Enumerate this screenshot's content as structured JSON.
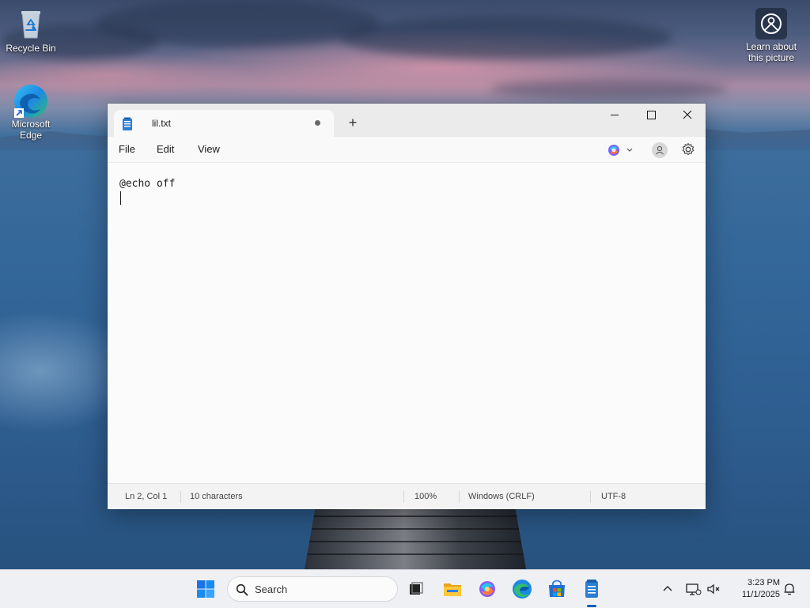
{
  "desktop": {
    "icons": [
      {
        "label": "Recycle Bin",
        "icon": "recycle-bin-icon"
      },
      {
        "label": "Microsoft Edge",
        "icon": "edge-icon"
      }
    ],
    "spotlight": {
      "label": "Learn about this picture",
      "icon": "camera-info-icon"
    }
  },
  "notepad": {
    "tab": {
      "title": "lil.txt",
      "unsaved_indicator": "•",
      "new_tab_symbol": "+"
    },
    "window_controls": [
      "minimize",
      "maximize",
      "close"
    ],
    "menu": {
      "file": "File",
      "edit": "Edit",
      "view": "View"
    },
    "toolbar_icons": [
      "copilot-icon",
      "account-icon",
      "settings-icon"
    ],
    "editor": {
      "content": "@echo off\n"
    },
    "status": {
      "position": "Ln 2, Col 1",
      "characters": "10 characters",
      "zoom": "100%",
      "line_ending": "Windows (CRLF)",
      "encoding": "UTF-8"
    }
  },
  "taskbar": {
    "search_placeholder": "Search",
    "apps": [
      "start",
      "task-view",
      "file-explorer",
      "copilot",
      "edge",
      "microsoft-store",
      "notepad"
    ],
    "active_app": "notepad",
    "clock": {
      "time": "3:23 PM",
      "date": "11/1/2025"
    }
  },
  "colors": {
    "accent": "#005fb8",
    "taskbar_bg": "#eef0f4",
    "window_bg": "#f9f9f9"
  }
}
